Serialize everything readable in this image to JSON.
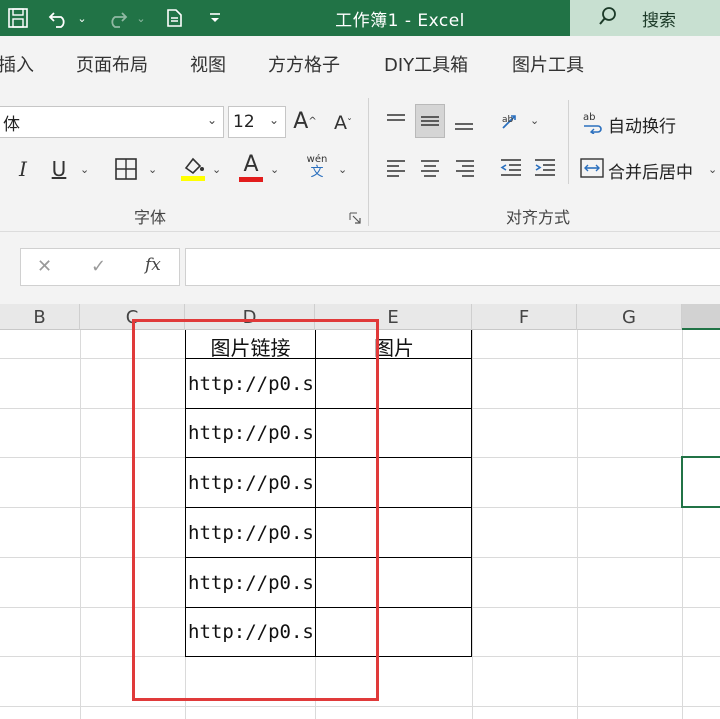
{
  "title_bar": {
    "document_title": "工作簿1  -  Excel",
    "search_label": "搜索",
    "icons": [
      "save-icon",
      "undo-icon",
      "redo-icon",
      "touch-mode-icon",
      "customize-toolbar-icon",
      "search-icon"
    ]
  },
  "ribbon_tabs": [
    "插入",
    "页面布局",
    "视图",
    "方方格子",
    "DIY工具箱",
    "图片工具"
  ],
  "font_group": {
    "font_name": "体",
    "font_size": "12",
    "italic": "I",
    "underline": "U",
    "font_color_letter": "A",
    "phonetic_top": "wén",
    "phonetic_bottom": "文",
    "group_label": "字体"
  },
  "alignment_group": {
    "wrap_text": "自动换行",
    "merge_center": "合并后居中",
    "group_label": "对齐方式"
  },
  "formula_bar": {
    "cancel": "✕",
    "enter": "✓",
    "fx": "fx",
    "content": ""
  },
  "columns": [
    "B",
    "C",
    "D",
    "E",
    "F",
    "G"
  ],
  "table": {
    "headers": [
      "图片链接",
      "图片"
    ],
    "rows": [
      {
        "link": "http://p0.s",
        "image": ""
      },
      {
        "link": "http://p0.s",
        "image": ""
      },
      {
        "link": "http://p0.s",
        "image": ""
      },
      {
        "link": "http://p0.s",
        "image": ""
      },
      {
        "link": "http://p0.s",
        "image": ""
      },
      {
        "link": "http://p0.s",
        "image": ""
      }
    ]
  },
  "colors": {
    "excel_green": "#217346",
    "highlight_yellow": "#ffff00",
    "font_red": "#e21d1d",
    "annotation_red": "#e03a3a"
  }
}
